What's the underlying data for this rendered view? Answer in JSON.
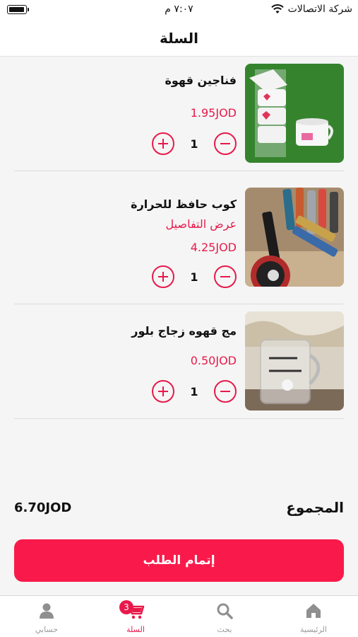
{
  "status_bar": {
    "carrier": "شركة الاتصالات",
    "time": "٧:٠٧ م"
  },
  "header": {
    "title": "السلة"
  },
  "cart": {
    "items": [
      {
        "name": "فناجين قهوة",
        "price": "1.95JOD",
        "quantity": "1"
      },
      {
        "name": "كوب حافظ للحرارة",
        "details_link": "عرض التفاصيل",
        "price": "4.25JOD",
        "quantity": "1"
      },
      {
        "name": "مج قهوه زجاج بلور",
        "price": "0.50JOD",
        "quantity": "1"
      }
    ]
  },
  "summary": {
    "total_label": "المجموع",
    "total_value": "6.70JOD"
  },
  "checkout": {
    "label": "إتمام الطلب"
  },
  "tabbar": {
    "tabs": [
      {
        "label": "الرئيسية",
        "icon": "home-icon"
      },
      {
        "label": "بحث",
        "icon": "search-icon"
      },
      {
        "label": "السلة",
        "icon": "cart-icon",
        "badge": "3",
        "active": true
      },
      {
        "label": "حسابي",
        "icon": "user-icon"
      }
    ]
  },
  "colors": {
    "accent": "#e8194a",
    "button": "#f91a4b"
  }
}
